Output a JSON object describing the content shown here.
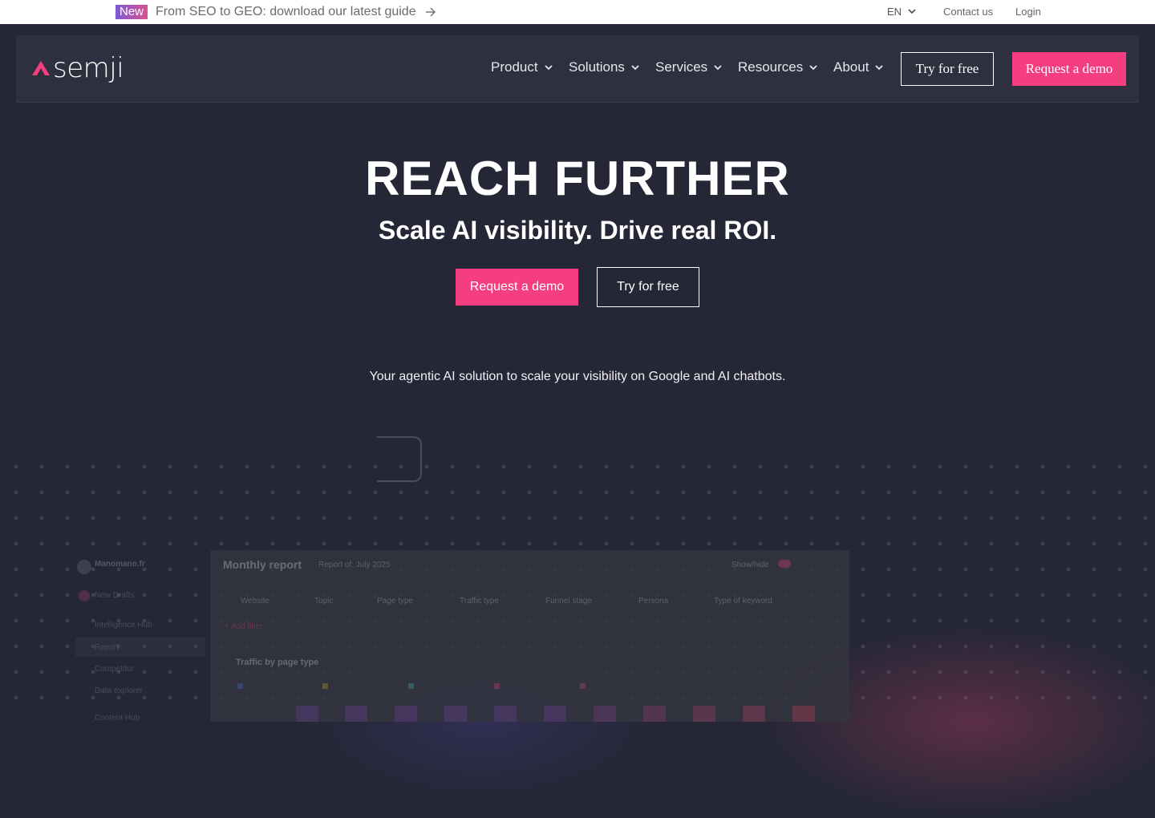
{
  "topbar": {
    "badge": "New",
    "promo": "From SEO to GEO: download our latest guide",
    "lang": "EN",
    "contact": "Contact us",
    "login": "Login"
  },
  "nav": {
    "logo": "semji",
    "menu": [
      "Product",
      "Solutions",
      "Services",
      "Resources",
      "About"
    ],
    "try_free": "Try for free",
    "request_demo": "Request a demo"
  },
  "hero": {
    "title": "REACH FURTHER",
    "subtitle": "Scale AI visibility. Drive real ROI.",
    "cta_demo": "Request a demo",
    "cta_try": "Try for free",
    "tagline": "Your agentic AI solution to scale your visibility on Google and AI chatbots."
  },
  "preview": {
    "sidebar": [
      "Manomano.fr",
      "New Drafts",
      "Intelligence Hub",
      "Report",
      "Competitor",
      "Data explorer",
      "Content Hub"
    ],
    "title": "Monthly report",
    "report_of": "Report of: July 2025",
    "filters": [
      "Website",
      "Topic",
      "Page type",
      "Traffic type",
      "Funnel stage",
      "Persona",
      "Type of keyword"
    ],
    "add_filter": "+ Add filter",
    "section": "Traffic by page type",
    "toggle": "Show/hide"
  },
  "colors": {
    "background": "#252736",
    "nav": "#2e303f",
    "accent": "#f53e7f"
  }
}
